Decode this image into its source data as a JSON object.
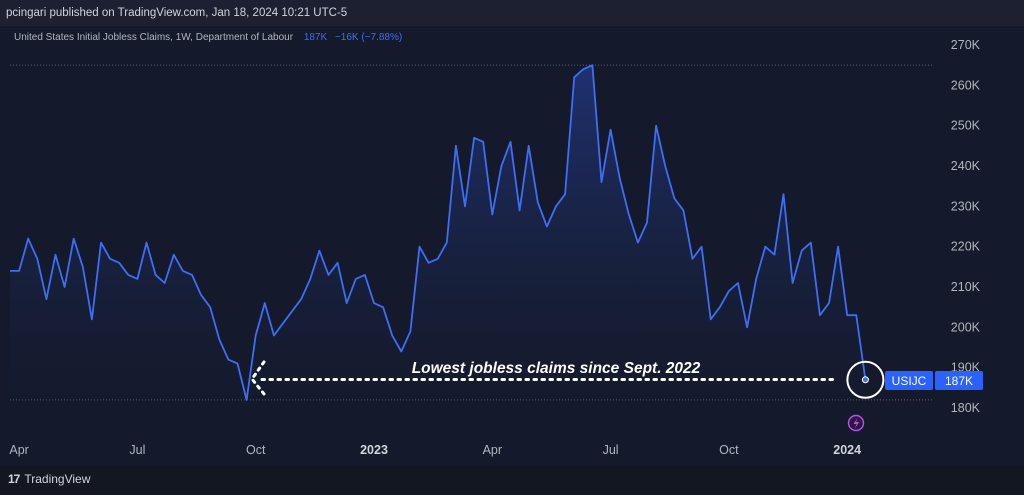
{
  "header": {
    "published": "pcingari published on TradingView.com, Jan 18, 2024 10:21 UTC-5"
  },
  "legend": {
    "title": "United States Initial Jobless Claims, 1W, Department of Labour",
    "value": "187K",
    "change": "−16K (−7.88%)"
  },
  "annotation": "Lowest jobless claims since Sept. 2022",
  "symbol_tag": "USIJC",
  "price_tag": "187K",
  "footer": {
    "brand": "TradingView",
    "logo_mark": "17"
  },
  "colors": {
    "line": "#3d6ef5",
    "background": "#141a2b",
    "tag": "#2962ff"
  },
  "chart_data": {
    "type": "area",
    "x_ticks": [
      {
        "label": "Apr",
        "index": 1,
        "bold": false
      },
      {
        "label": "Jul",
        "index": 14,
        "bold": false
      },
      {
        "label": "Oct",
        "index": 27,
        "bold": false
      },
      {
        "label": "2023",
        "index": 40,
        "bold": true
      },
      {
        "label": "Apr",
        "index": 53,
        "bold": false
      },
      {
        "label": "Jul",
        "index": 66,
        "bold": false
      },
      {
        "label": "Oct",
        "index": 79,
        "bold": false
      },
      {
        "label": "2024",
        "index": 92,
        "bold": true
      }
    ],
    "y_ticks": [
      "180K",
      "190K",
      "200K",
      "210K",
      "220K",
      "230K",
      "240K",
      "250K",
      "260K",
      "270K"
    ],
    "ylim": [
      176,
      273
    ],
    "values": [
      214,
      214,
      222,
      217,
      207,
      218,
      210,
      222,
      215,
      202,
      221,
      217,
      216,
      213,
      212,
      221,
      213,
      211,
      218,
      214,
      213,
      208,
      205,
      197,
      192,
      191,
      182,
      198,
      206,
      198,
      201,
      204,
      207,
      212,
      219,
      213,
      216,
      206,
      212,
      213,
      206,
      205,
      198,
      194,
      199,
      220,
      216,
      217,
      221,
      245,
      230,
      247,
      246,
      228,
      240,
      246,
      229,
      245,
      231,
      225,
      230,
      233,
      262,
      264,
      265,
      236,
      249,
      237,
      228,
      221,
      226,
      250,
      240,
      232,
      229,
      217,
      220,
      202,
      205,
      209,
      211,
      200,
      212,
      220,
      218,
      233,
      211,
      219,
      221,
      203,
      206,
      220,
      203,
      203,
      187
    ],
    "reference_lines": [
      265,
      182
    ]
  }
}
